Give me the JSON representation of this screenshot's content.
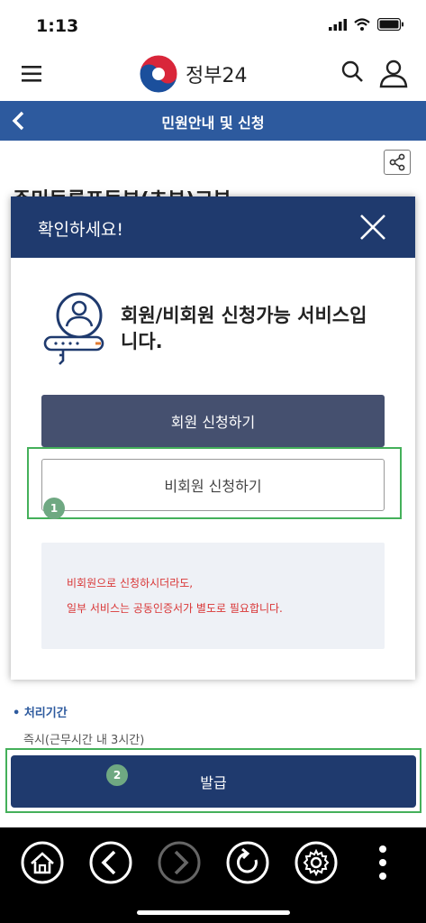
{
  "status_bar": {
    "time": "1:13"
  },
  "header": {
    "logo_text": "정부24"
  },
  "nav": {
    "title": "민원안내 및 신청"
  },
  "background": {
    "heading": "주민등록표등본(초본)교부"
  },
  "modal": {
    "title": "확인하세요!",
    "message_line1": "회원/비회원 신청가능 서비스입",
    "message_line2": "니다.",
    "member_button": "회원 신청하기",
    "nonmember_button": "비회원 신청하기",
    "notice_line1": "비회원으로 신청하시더라도,",
    "notice_line2": "일부 서비스는 공동인증서가 별도로 필요합니다."
  },
  "info": {
    "heading": "• 처리기간",
    "value": "즉시(근무시간 내 3시간)"
  },
  "issue_button": "발급",
  "annotations": {
    "step1": "1",
    "step2": "2"
  },
  "toolbar": {
    "items": [
      "home",
      "back",
      "forward",
      "reload",
      "settings",
      "more"
    ]
  },
  "colors": {
    "nav": "#2d5a9e",
    "modal_header": "#1f3a6e",
    "highlight": "#44b05a",
    "notice_text": "#d93535"
  }
}
